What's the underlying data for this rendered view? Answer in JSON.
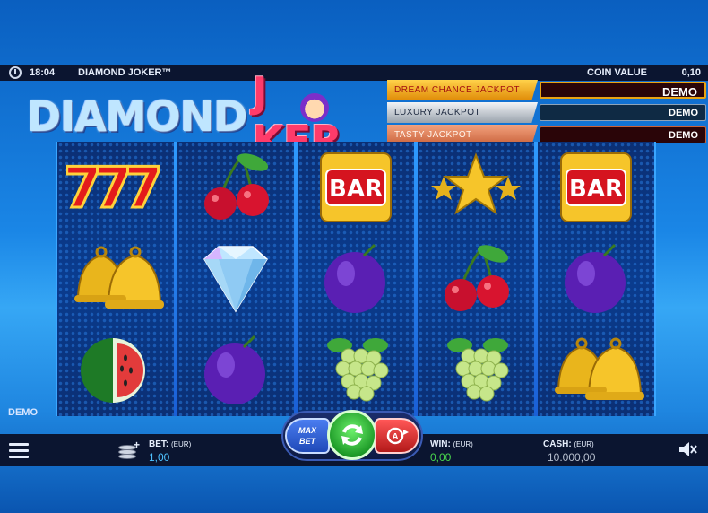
{
  "top_bar": {
    "time": "18:04",
    "title": "DIAMOND JOKER™",
    "coin_value_label": "COIN VALUE",
    "coin_value": "0,10"
  },
  "logo": {
    "word1": "DIAMOND",
    "word2_left": "J",
    "word2_right": "KER"
  },
  "jackpots": [
    {
      "label": "DREAM CHANCE JACKPOT",
      "value": "DEMO"
    },
    {
      "label": "LUXURY JACKPOT",
      "value": "DEMO"
    },
    {
      "label": "TASTY JACKPOT",
      "value": "DEMO"
    }
  ],
  "reels": [
    [
      "seven-triple-icon",
      "bell-icon",
      "watermelon-icon"
    ],
    [
      "cherry-icon",
      "diamond-icon",
      "plum-icon"
    ],
    [
      "bar-icon",
      "plum-icon",
      "grapes-icon"
    ],
    [
      "star-icon",
      "cherry-icon",
      "grapes-icon"
    ],
    [
      "bar-icon",
      "plum-icon",
      "bell-icon"
    ]
  ],
  "symbols": {
    "bar_text": "BAR",
    "seven_text": "777"
  },
  "demo_label": "DEMO",
  "bottom_bar": {
    "bet_label": "BET:",
    "bet_currency": "(EUR)",
    "bet_value": "1,00",
    "win_label": "WIN:",
    "win_currency": "(EUR)",
    "win_value": "0,00",
    "cash_label": "CASH:",
    "cash_currency": "(EUR)",
    "cash_value": "10.000,00"
  },
  "controls": {
    "maxbet_line1": "MAX",
    "maxbet_line2": "BET"
  },
  "colors": {
    "bet": "#4fc3ff",
    "win": "#49d64d",
    "spin": "#2ec03a",
    "autoplay": "#d92525"
  }
}
